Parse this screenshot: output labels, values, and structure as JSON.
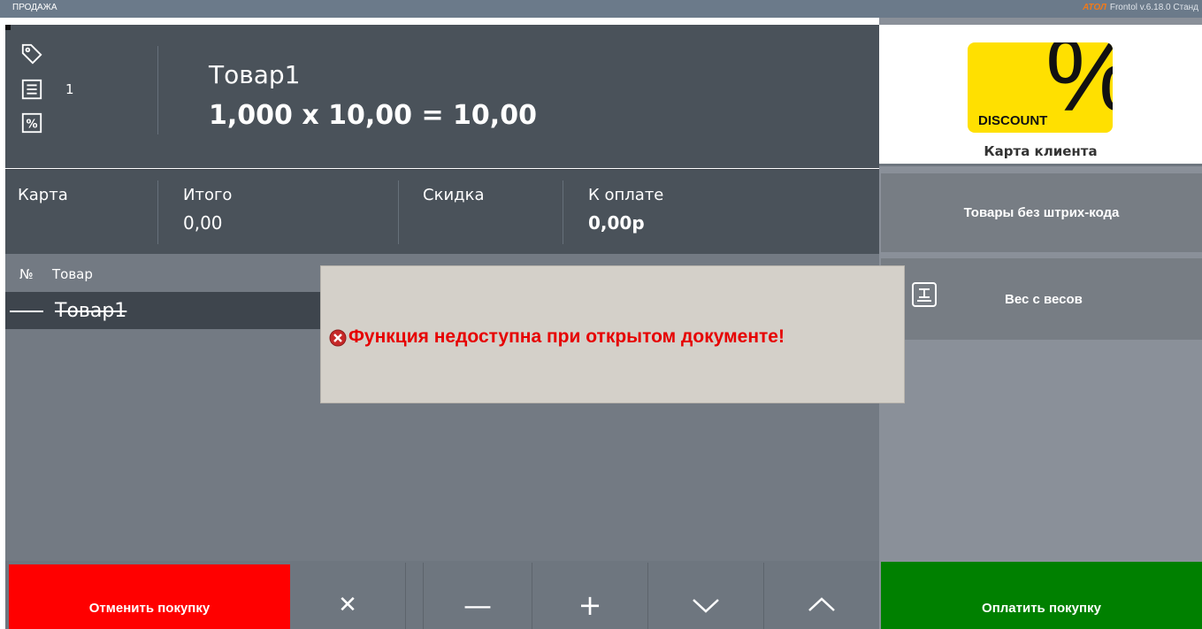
{
  "titlebar": {
    "mode": "ПРОДАЖА",
    "brand": "АТОЛ",
    "version": "Frontol v.6.18.0 Станд"
  },
  "product": {
    "position": "1",
    "name": "Товар1",
    "calc": "1,000 x 10,00 = 10,00",
    "icons": [
      "tag-icon",
      "list-icon",
      "percent-icon"
    ]
  },
  "totals": {
    "card_label": "Карта",
    "total_label": "Итого",
    "total_value": "0,00",
    "discount_label": "Скидка",
    "topay_label": "К оплате",
    "topay_value": "0,00р"
  },
  "list": {
    "col_num": "№",
    "col_name": "Товар",
    "rows": [
      {
        "name": "Товар1",
        "struck": true
      }
    ]
  },
  "bottom": {
    "cancel_label": "Отменить покупку",
    "delete_symbol": "✕",
    "minus_symbol": "—",
    "plus_symbol": "+",
    "down_icon": "chevron-down-icon",
    "up_icon": "chevron-up-icon"
  },
  "right": {
    "card_image_text": "DISCOUNT",
    "card_image_symbol": "%",
    "card_label": "Карта клиента",
    "nobarcode_label": "Товары без штрих-кода",
    "scale_label": "Вес с весов",
    "pay_label": "Оплатить покупку"
  },
  "dialog": {
    "message": "Функция недоступна при открытом документе!"
  },
  "colors": {
    "cancel": "#ff0000",
    "pay": "#008000",
    "error_text": "#e60000",
    "card_yellow": "#ffe000",
    "panel_dark": "#4a525a"
  }
}
